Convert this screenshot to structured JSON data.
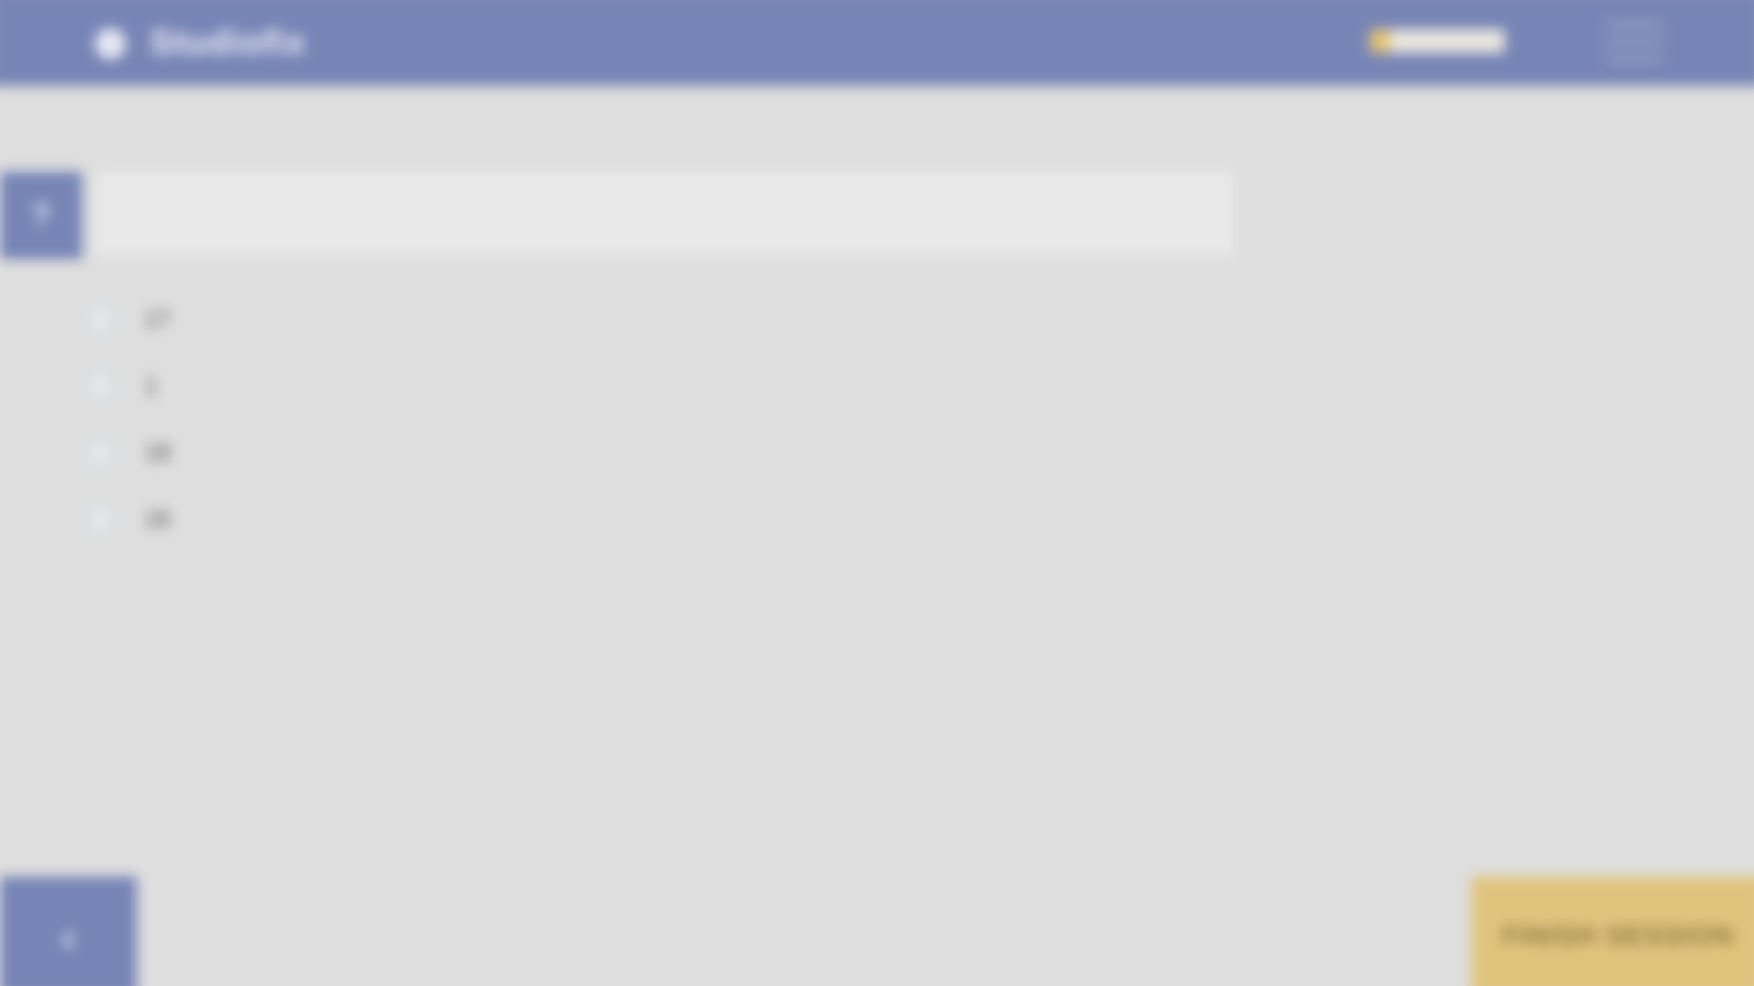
{
  "header": {
    "brand_name": "Studiofix",
    "breadcrumb": "",
    "premium_link_label": "",
    "progress_fraction": 0.15,
    "menu_icon": "hamburger-menu-icon"
  },
  "question": {
    "marker": "?",
    "text": "",
    "answers": [
      {
        "label": "17"
      },
      {
        "label": "1"
      },
      {
        "label": "18"
      },
      {
        "label": "16"
      }
    ]
  },
  "footer": {
    "prev_icon": "chevron-left-icon",
    "prev_glyph": "‹",
    "submit_label": "FINISH SESSION"
  },
  "colors": {
    "primary": "#7785b6",
    "accent": "#e0c47e",
    "background": "#dedede"
  }
}
